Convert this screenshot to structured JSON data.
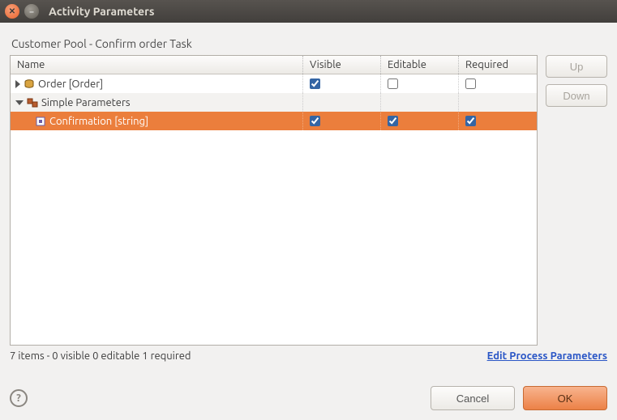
{
  "window": {
    "title": "Activity Parameters"
  },
  "subtitle": "Customer Pool  - Confirm order Task",
  "columns": {
    "name": "Name",
    "visible": "Visible",
    "editable": "Editable",
    "required": "Required"
  },
  "rows": {
    "order": {
      "label": "Order [Order]",
      "visible": true,
      "editable": false,
      "required": false
    },
    "simpleHeader": {
      "label": "Simple Parameters"
    },
    "confirmation": {
      "label": "Confirmation [string]",
      "visible": true,
      "editable": true,
      "required": true
    }
  },
  "buttons": {
    "up": "Up",
    "down": "Down",
    "cancel": "Cancel",
    "ok": "OK"
  },
  "status": "7 items - 0 visible  0 editable  1 required",
  "link": "Edit Process Parameters",
  "help": "?"
}
